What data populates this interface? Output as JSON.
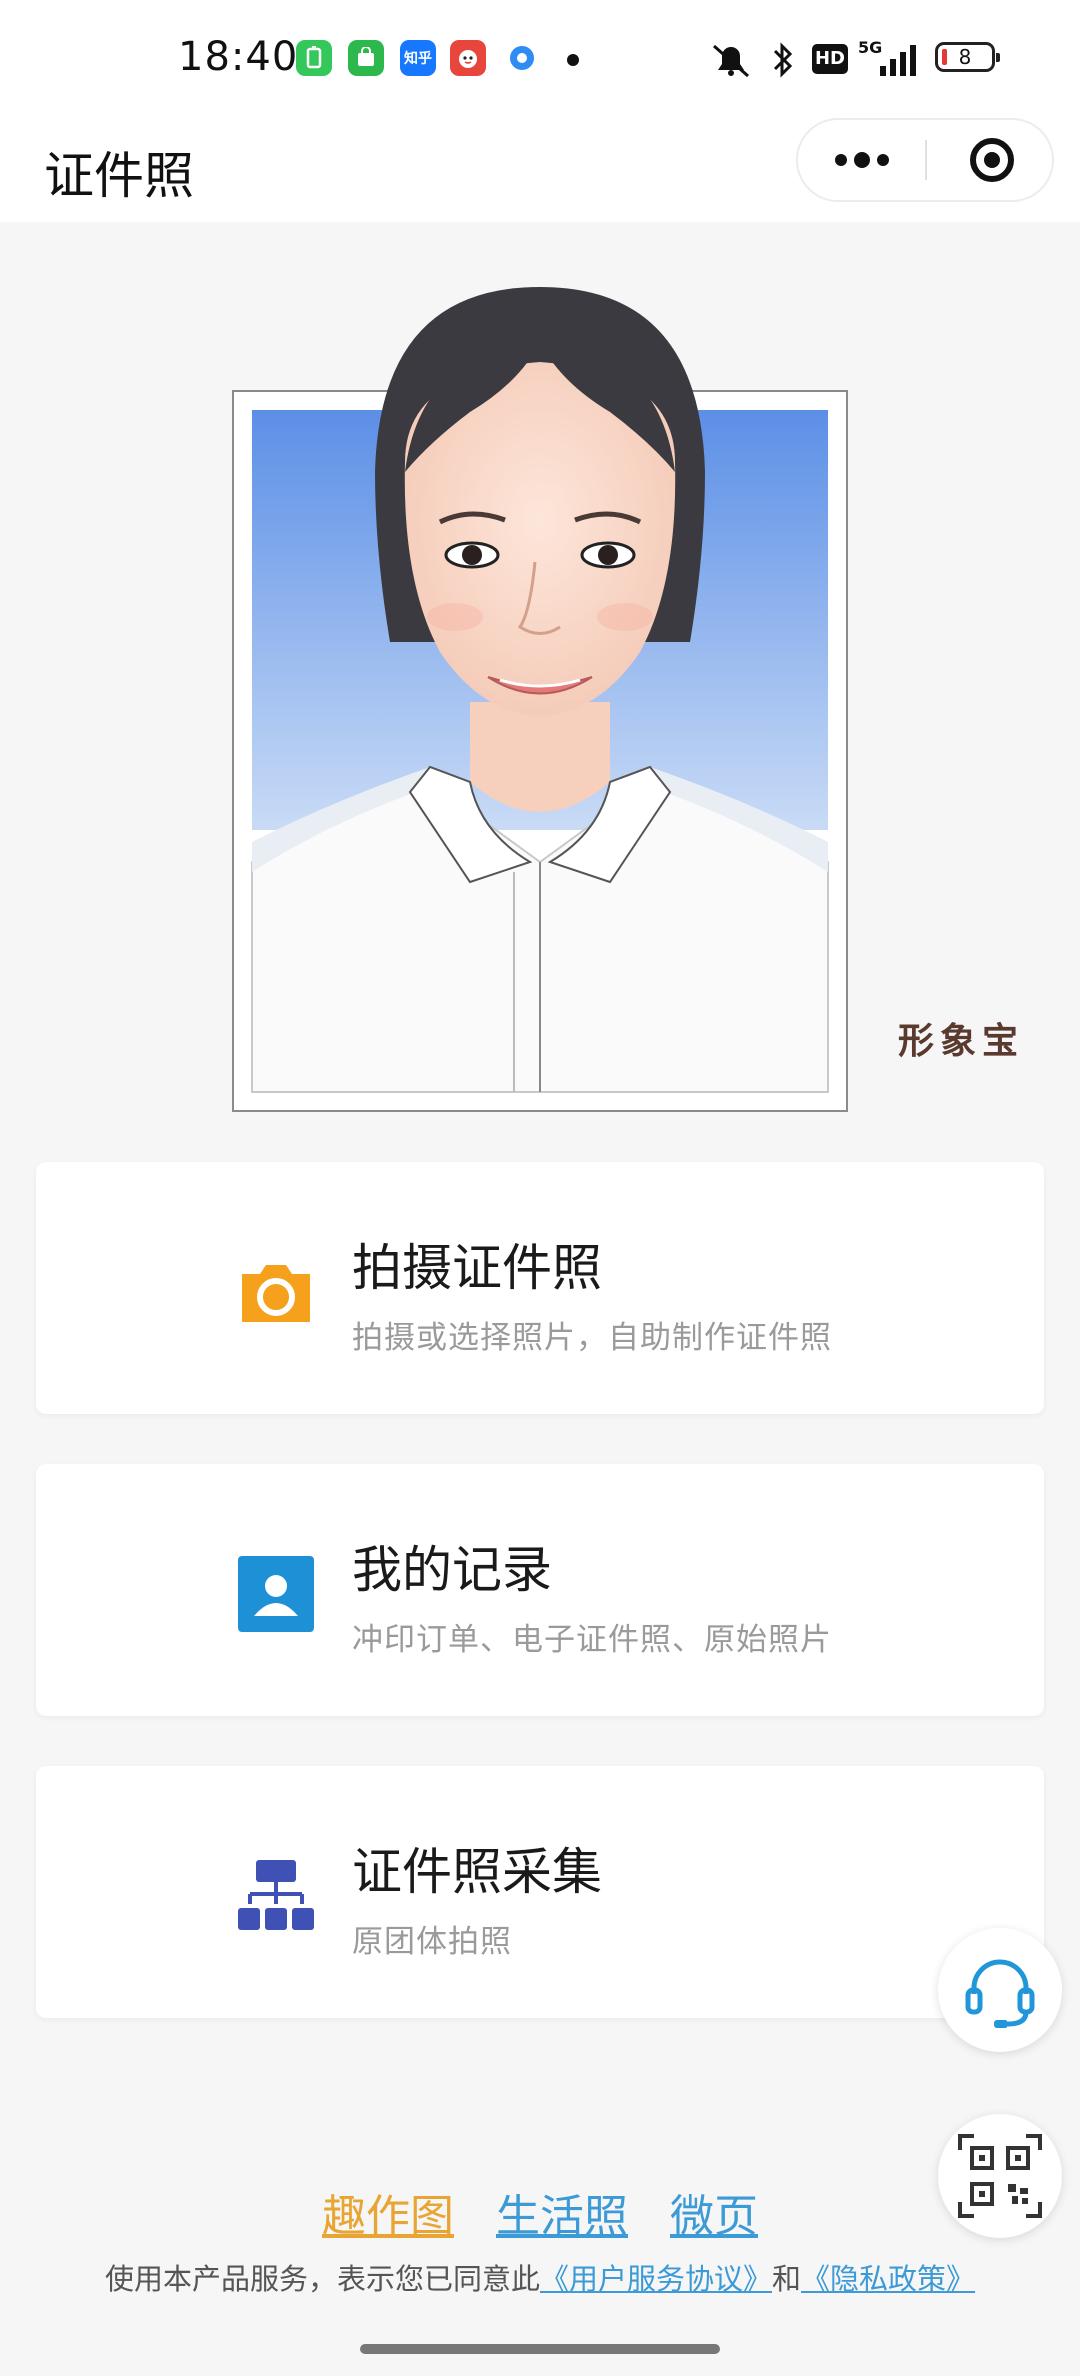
{
  "status_bar": {
    "time": "18:40",
    "battery": "8",
    "app_icons": [
      {
        "name": "battery-app-icon",
        "color": "#34c759",
        "glyph": "▯"
      },
      {
        "name": "shopping-app-icon",
        "color": "#2db84d",
        "glyph": "❖"
      },
      {
        "name": "zhihu-app-icon",
        "color": "#1677ff",
        "glyph": "知乎"
      },
      {
        "name": "red-mascot-app-icon",
        "color": "#e8453c",
        "glyph": "●"
      },
      {
        "name": "blue-circle-app-icon",
        "color": "#2f8cf0",
        "glyph": "◉"
      }
    ],
    "network_badge": "HD",
    "network_type": "5G"
  },
  "nav": {
    "title": "证件照",
    "more_icon": "more-dots-icon",
    "close_icon": "target-close-icon"
  },
  "hero": {
    "brand": "形象宝",
    "bg_color": "#5b8fe6"
  },
  "cards": [
    {
      "title": "拍摄证件照",
      "subtitle": "拍摄或选择照片，自助制作证件照",
      "icon": "camera-icon",
      "icon_color": "#f5a11c"
    },
    {
      "title": "我的记录",
      "subtitle": "冲印订单、电子证件照、原始照片",
      "icon": "user-card-icon",
      "icon_color": "#1e90d6"
    },
    {
      "title": "证件照采集",
      "subtitle": "原团体拍照",
      "icon": "org-chart-icon",
      "icon_color": "#3f51b5"
    }
  ],
  "floating": {
    "support_icon": "headset-icon",
    "qr_icon": "qr-code-icon"
  },
  "footer": {
    "links": [
      "趣作图",
      "生活照",
      "微页"
    ],
    "agreement_prefix": "使用本产品服务，表示您已同意此",
    "agreement_link1": "《用户服务协议》",
    "agreement_and": "和",
    "agreement_link2": "《隐私政策》"
  }
}
